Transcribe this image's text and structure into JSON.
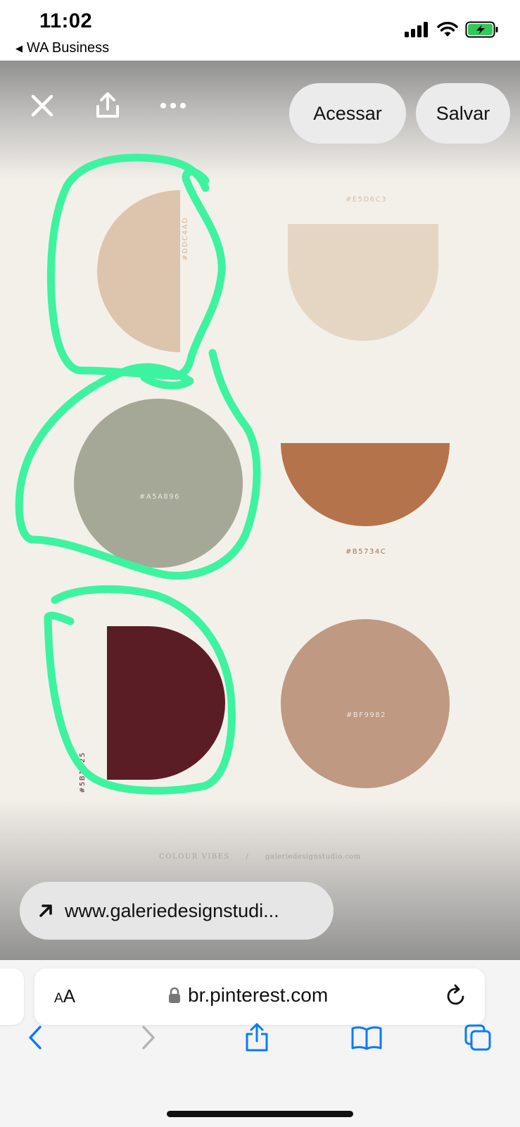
{
  "status_bar": {
    "time": "11:02",
    "back_app": "WA Business",
    "icons": [
      "cellular-signal-icon",
      "wifi-icon",
      "battery-charging-icon"
    ]
  },
  "pin_viewer": {
    "toolbar": {
      "close_icon": "close-icon",
      "share_icon": "share-icon",
      "more_icon": "more-icon",
      "visit_label": "Acessar",
      "save_label": "Salvar"
    },
    "source_link": "www.galeriedesignstudi..."
  },
  "palette": {
    "swatches": [
      {
        "hex": "#DDC4AD",
        "color": "#ddc4ad",
        "shape": "half-circle-left"
      },
      {
        "hex": "#E5D6C3",
        "color": "#e5d6c3",
        "shape": "arch-down"
      },
      {
        "hex": "#A5A896",
        "color": "#a5a896",
        "shape": "circle"
      },
      {
        "hex": "#B5734C",
        "color": "#b5734c",
        "shape": "half-circle-down"
      },
      {
        "hex": "#5B1D25",
        "color": "#5b1d25",
        "shape": "half-circle-right"
      },
      {
        "hex": "#BF9982",
        "color": "#bf9982",
        "shape": "circle"
      }
    ],
    "caption_left": "COLOUR VIBES",
    "caption_sep": "/",
    "caption_right": "galeriedesignstudio.com",
    "highlight_color": "#3ef3a0"
  },
  "safari": {
    "aa_label": "AA",
    "domain": "br.pinterest.com",
    "toolbar_icons": [
      "back-icon",
      "forward-icon",
      "share-icon",
      "bookmarks-icon",
      "tabs-icon"
    ],
    "accent": "#0a7aff"
  }
}
